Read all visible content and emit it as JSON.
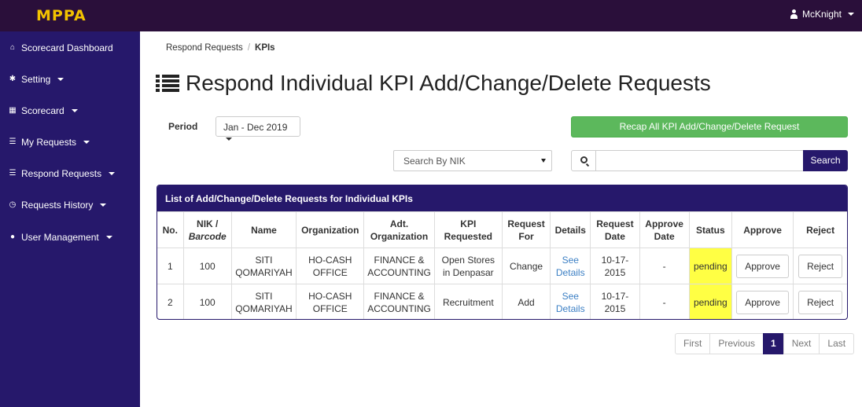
{
  "app": {
    "brand": "MPPA",
    "user_name": "McKnight"
  },
  "sidebar": {
    "items": [
      {
        "label": "Scorecard Dashboard",
        "icon": "home-icon",
        "has_caret": false
      },
      {
        "label": "Setting",
        "icon": "gear-icon",
        "has_caret": true
      },
      {
        "label": "Scorecard",
        "icon": "table-icon",
        "has_caret": true
      },
      {
        "label": "My Requests",
        "icon": "list-icon",
        "has_caret": true
      },
      {
        "label": "Respond Requests",
        "icon": "list-icon",
        "has_caret": true
      },
      {
        "label": "Requests History",
        "icon": "clock-icon",
        "has_caret": true
      },
      {
        "label": "User Management",
        "icon": "user-icon",
        "has_caret": true
      }
    ]
  },
  "breadcrumb": {
    "parent": "Respond Requests",
    "separator": "/",
    "current": "KPIs"
  },
  "page": {
    "title": "Respond Individual KPI Add/Change/Delete Requests"
  },
  "filters": {
    "period_label": "Period",
    "period_value": "Jan - Dec 2019",
    "recap_button": "Recap All KPI Add/Change/Delete Request",
    "search_by_select": "Search By NIK",
    "search_value": "",
    "search_button": "Search"
  },
  "panel": {
    "title": "List of Add/Change/Delete Requests for Individual KPIs",
    "headers": {
      "no": "No.",
      "nik": "NIK /",
      "nik_sub": "Barcode",
      "name": "Name",
      "organization": "Organization",
      "adt_org": "Adt. Organization",
      "kpi_requested": "KPI Requested",
      "request_for": "Request For",
      "details": "Details",
      "request_date": "Request Date",
      "approve_date": "Approve Date",
      "status": "Status",
      "approve": "Approve",
      "reject": "Reject"
    },
    "rows": [
      {
        "no": "1",
        "nik": "100",
        "name": "SITI QOMARIYAH",
        "organization": "HO-CASH OFFICE",
        "adt_org": "FINANCE & ACCOUNTING",
        "kpi_requested": "Open Stores in Denpasar",
        "request_for": "Change",
        "details": "See Details",
        "request_date": "10-17-2015",
        "approve_date": "-",
        "status": "pending",
        "approve": "Approve",
        "reject": "Reject"
      },
      {
        "no": "2",
        "nik": "100",
        "name": "SITI QOMARIYAH",
        "organization": "HO-CASH OFFICE",
        "adt_org": "FINANCE & ACCOUNTING",
        "kpi_requested": "Recruitment",
        "request_for": "Add",
        "details": "See Details",
        "request_date": "10-17-2015",
        "approve_date": "-",
        "status": "pending",
        "approve": "Approve",
        "reject": "Reject"
      }
    ]
  },
  "pagination": {
    "first": "First",
    "previous": "Previous",
    "current": "1",
    "next": "Next",
    "last": "Last"
  },
  "colors": {
    "topbar": "#2a0f3a",
    "sidebar": "#26186b",
    "brand": "#f2c200",
    "success": "#5cb85c",
    "pending": "#ffff44",
    "link": "#3b7fc4"
  }
}
